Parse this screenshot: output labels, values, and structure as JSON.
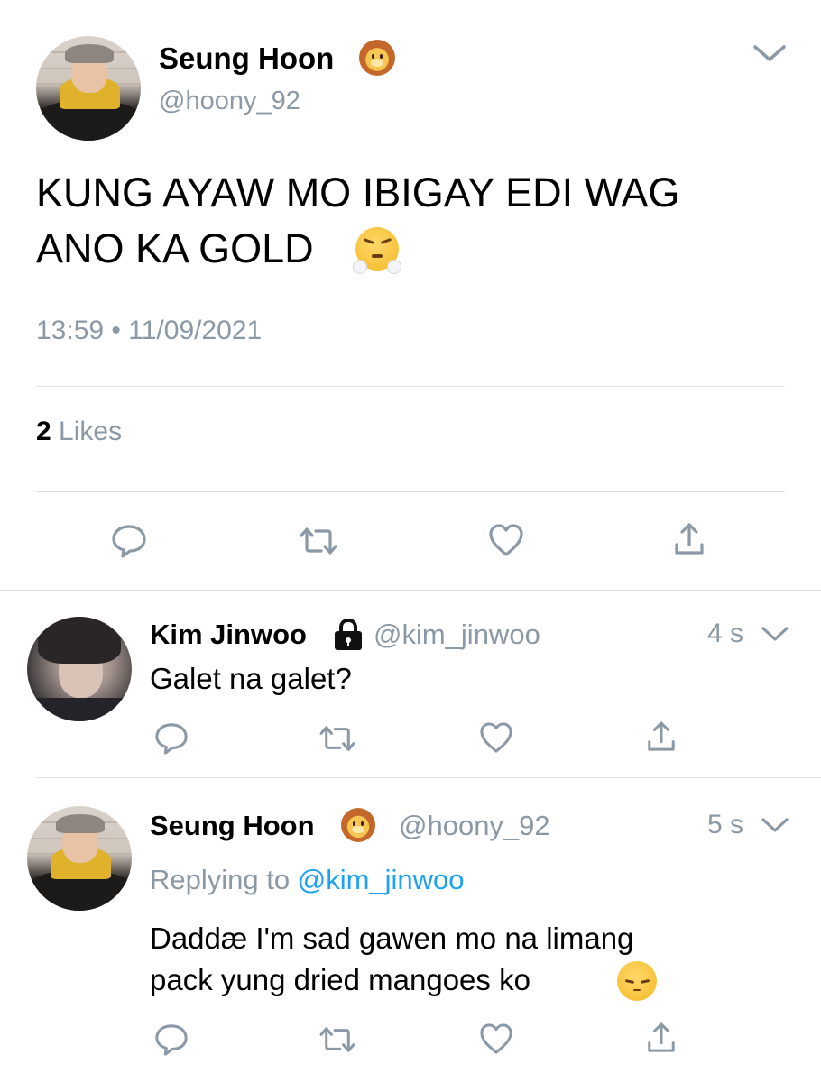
{
  "main_tweet": {
    "display_name": "Seung Hoon",
    "handle": "@hoony_92",
    "text_line1": "KUNG AYAW MO IBIGAY EDI WAG",
    "text_line2": "ANO KA GOLD",
    "time": "13:59",
    "separator": "•",
    "date": "11/09/2021",
    "likes_count": "2",
    "likes_label": "Likes"
  },
  "replies": [
    {
      "display_name": "Kim Jinwoo",
      "handle": "@kim_jinwoo",
      "age": "4 s",
      "text": "Galet na galet?"
    },
    {
      "display_name": "Seung Hoon",
      "handle": "@hoony_92",
      "age": "5 s",
      "replying_prefix": "Replying to",
      "replying_handle": "@kim_jinwoo",
      "text_line1": "Daddæ I'm sad gawen mo na limang",
      "text_line2": "pack yung dried mangoes ko"
    }
  ],
  "colors": {
    "accent": "#1da1f2",
    "secondary_text": "#8b98a5",
    "icon": "#8b98a5",
    "divider": "#dfe3e6"
  },
  "icons": [
    "chevron-down-icon",
    "reply-icon",
    "retweet-icon",
    "like-icon",
    "share-icon",
    "lock-icon",
    "lion-emoji",
    "steam-from-nose-emoji",
    "pensive-emoji"
  ]
}
